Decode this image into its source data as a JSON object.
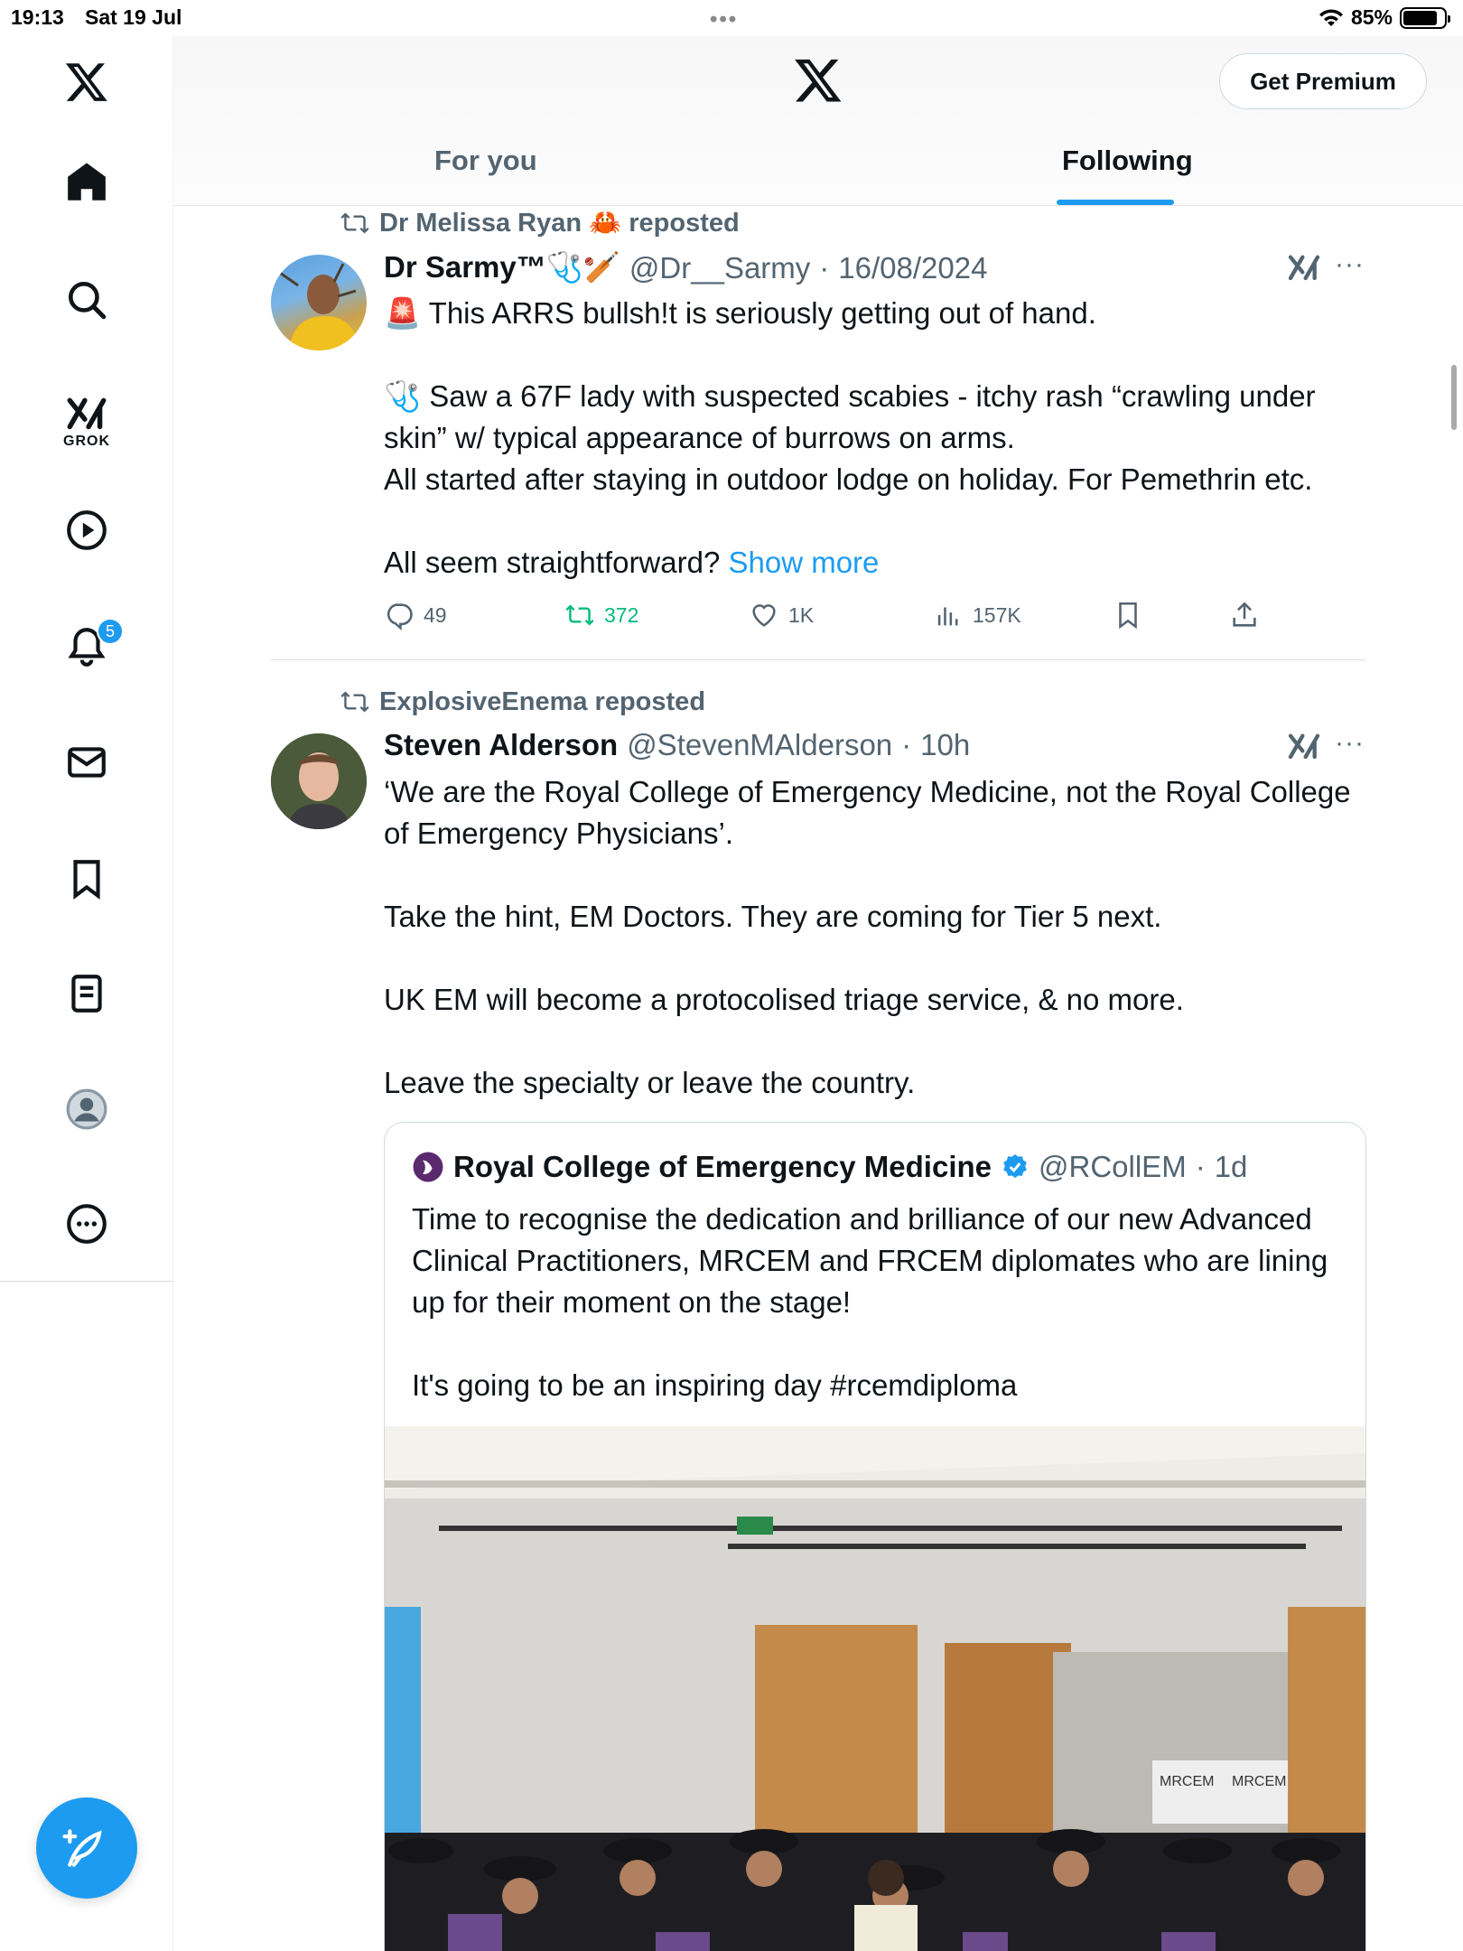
{
  "status_bar": {
    "time": "19:13",
    "date": "Sat 19 Jul",
    "battery": "85%",
    "dots": "•••"
  },
  "sidebar": {
    "grok_label": "GROK",
    "notifications_count": "5"
  },
  "header": {
    "premium_label": "Get Premium"
  },
  "tabs": [
    {
      "label": "For you"
    },
    {
      "label": "Following"
    }
  ],
  "posts": [
    {
      "repost_by": "Dr Melissa Ryan 🦀 reposted",
      "name": "Dr Sarmy™🩺🏏",
      "handle": "@Dr__Sarmy",
      "date": "16/08/2024",
      "text": "🚨 This ARRS bullsh!t is seriously getting out of hand.\n\n🩺 Saw a 67F lady with suspected scabies - itchy rash “crawling under skin” w/ typical appearance of burrows on arms.\nAll started after staying in outdoor lodge on holiday. For Pemethrin etc.\n\nAll seem straightforward? ",
      "show_more": "Show more",
      "replies": "49",
      "reposts": "372",
      "likes": "1K",
      "views": "157K"
    },
    {
      "repost_by": "ExplosiveEnema reposted",
      "name": "Steven Alderson",
      "handle": "@StevenMAlderson",
      "date": "10h",
      "text": "‘We are the Royal College of Emergency Medicine, not the Royal College of Emergency Physicians’.\n\nTake the hint, EM Doctors. They are coming for Tier 5 next.\n\nUK EM will become a protocolised triage service, & no more.\n\nLeave the specialty or leave the country.",
      "quote": {
        "name": "Royal College of Emergency Medicine",
        "handle": "@RCollEM",
        "date": "1d",
        "text": "Time to recognise the dedication and brilliance of our new Advanced Clinical Practitioners, MRCEM and FRCEM diplomates who are lining up for their moment on the stage!\n\nIt's going to be an inspiring day #rcemdiploma",
        "image_signs": [
          "MRCEM",
          "MRCEM"
        ]
      }
    }
  ],
  "colors": {
    "accent": "#1d9bf0",
    "repost_green": "#00ba7c",
    "muted": "#536471"
  }
}
